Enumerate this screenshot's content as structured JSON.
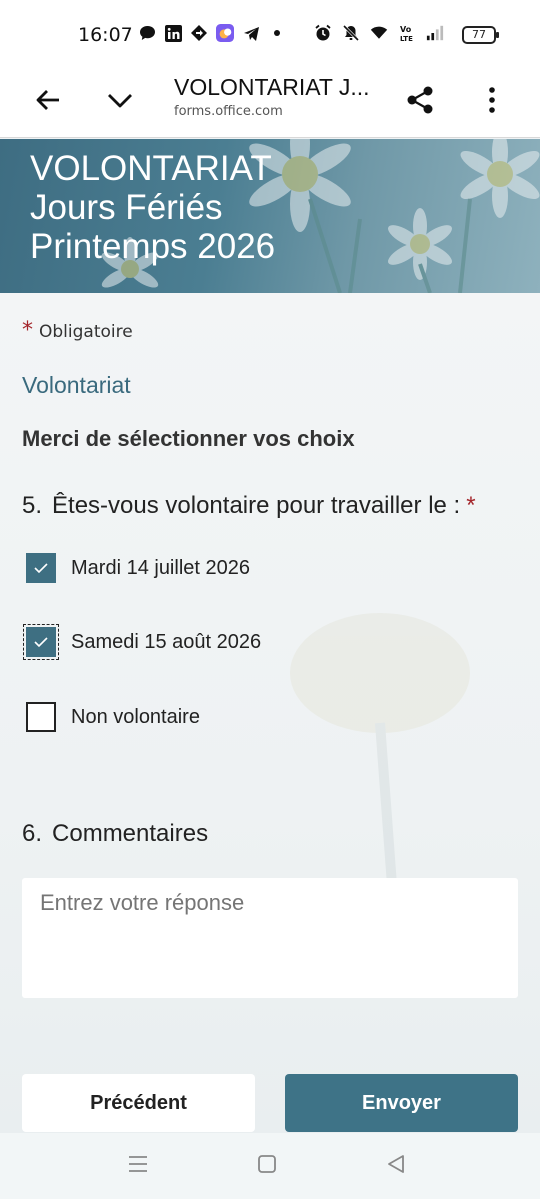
{
  "status_bar": {
    "time": "16:07",
    "battery": "77",
    "left_icons": [
      "chat-bubble-icon",
      "linkedin-icon",
      "navigation-icon",
      "app-icon",
      "telegram-icon",
      "dot-icon"
    ],
    "right_icons": [
      "alarm-icon",
      "mute-icon",
      "wifi-icon",
      "volte-icon",
      "signal-icon"
    ]
  },
  "browser": {
    "title": "VOLONTARIAT J...",
    "url": "forms.office.com",
    "icons": [
      "back-arrow-icon",
      "chevron-down-icon",
      "share-icon",
      "more-vert-icon"
    ]
  },
  "banner": {
    "title": "VOLONTARIAT\nJours Fériés\nPrintemps 2026"
  },
  "form": {
    "required_star": "*",
    "required_label": "Obligatoire",
    "section_title": "Volontariat",
    "section_description": "Merci de sélectionner vos choix",
    "question5": {
      "number": "5.",
      "title": "Êtes-vous volontaire pour travailler le :",
      "required_star": "*",
      "options": [
        {
          "label": "Mardi 14 juillet 2026",
          "checked": true
        },
        {
          "label": "Samedi 15 août 2026",
          "checked": true
        },
        {
          "label": "Non volontaire",
          "checked": false
        }
      ]
    },
    "question6": {
      "number": "6.",
      "title": "Commentaires",
      "placeholder": "Entrez votre réponse"
    },
    "buttons": {
      "previous": "Précédent",
      "submit": "Envoyer"
    }
  },
  "nav_bar": {
    "icons": [
      "recents-icon",
      "home-icon",
      "back-icon"
    ]
  },
  "colors": {
    "accent": "#3e7387",
    "required": "#a4262c",
    "section_title": "#3a6a7e"
  }
}
